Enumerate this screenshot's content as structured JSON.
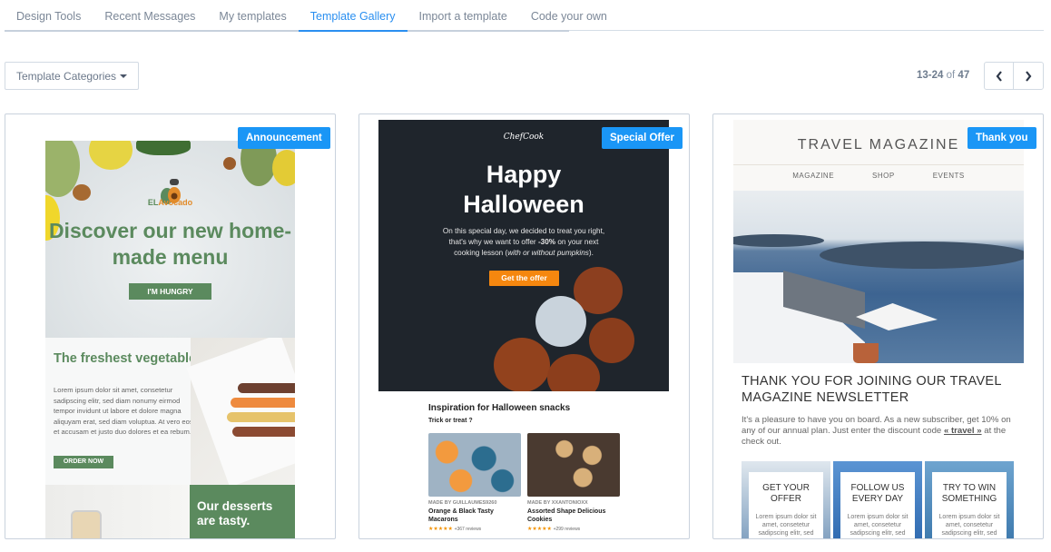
{
  "tabs": [
    {
      "label": "Design Tools",
      "active": false
    },
    {
      "label": "Recent Messages",
      "active": false
    },
    {
      "label": "My templates",
      "active": false
    },
    {
      "label": "Template Gallery",
      "active": true
    },
    {
      "label": "Import a template",
      "active": false
    },
    {
      "label": "Code your own",
      "active": false
    }
  ],
  "filter": {
    "label": "Template Categories"
  },
  "pagination": {
    "range": "13-24",
    "of": "of",
    "total": "47",
    "prev_icon": "chevron-left-icon",
    "next_icon": "chevron-right-icon"
  },
  "accent_color": "#1a96f6",
  "templates": [
    {
      "badge": "Announcement",
      "brand_prefix": "EL",
      "brand_name": "Avocado",
      "headline": "Discover our new home-made menu",
      "cta": "I'M HUNGRY",
      "section_title": "The freshest vegetables for you.",
      "section_text": "Lorem ipsum dolor sit amet, consetetur sadipscing elitr, sed diam nonumy eirmod tempor invidunt ut labore et dolore magna aliquyam erat, sed diam voluptua. At vero eos et accusam et justo duo dolores et ea rebum.",
      "section_cta": "ORDER NOW",
      "footer_title": "Our desserts are tasty."
    },
    {
      "badge": "Special Offer",
      "brand": "ChefCook",
      "headline_1": "Happy",
      "headline_2": "Halloween",
      "text_1": "On  this special day, we decided to treat you right,",
      "text_2a": "that's why we want to offer ",
      "text_2b": "-30%",
      "text_2c": " on your next",
      "text_3a": "cooking lesson (",
      "text_3b": "with or without pumpkins",
      "text_3c": ").",
      "cta": "Get the offer",
      "section_title": "Inspiration for Halloween snacks",
      "section_sub": "Trick or treat ?",
      "snacks": [
        {
          "by": "MADE BY GUILLAUMES9260",
          "title": "Orange & Black Tasty Macarons",
          "stars": "★★★★★",
          "reviews": "+367 reviews"
        },
        {
          "by": "MADE BY XXANTONIOXX",
          "title": "Assorted Shape Delicious Cookies",
          "stars": "★★★★★",
          "reviews": "+299 reviews"
        }
      ]
    },
    {
      "badge": "Thank you",
      "title": "TRAVEL MAGAZINE",
      "nav": [
        "MAGAZINE",
        "SHOP",
        "EVENTS"
      ],
      "headline": "THANK YOU FOR JOINING OUR TRAVEL MAGAZINE NEWSLETTER",
      "text_a": "It's a pleasure to have you on board. As a new subscriber, get 10% on any of our annual plan.  Just enter the discount code ",
      "code": "« travel »",
      "text_b": "  at the check out.",
      "tiles": [
        {
          "title": "GET YOUR OFFER",
          "text": "Lorem ipsum dolor sit amet, consetetur sadipscing elitr, sed"
        },
        {
          "title": "FOLLOW US EVERY DAY",
          "text": "Lorem ipsum dolor sit amet, consetetur sadipscing elitr, sed"
        },
        {
          "title": "TRY TO WIN SOMETHING",
          "text": "Lorem ipsum dolor sit amet, consetetur sadipscing elitr, sed"
        }
      ]
    }
  ]
}
